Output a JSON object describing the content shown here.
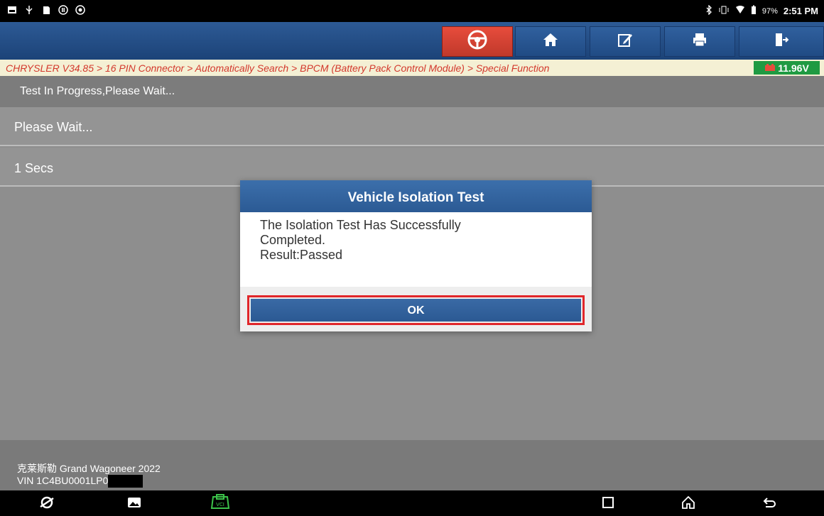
{
  "statusbar": {
    "time": "2:51 PM",
    "battery_percent": "97%"
  },
  "breadcrumb": "CHRYSLER V34.85 > 16 PIN Connector > Automatically Search > BPCM (Battery Pack Control Module) > Special Function",
  "battery_voltage": "11.96V",
  "rows": {
    "status": "Test In Progress,Please Wait...",
    "message": "Please Wait...",
    "timer": "1 Secs"
  },
  "footer": {
    "vehicle": "克莱斯勒 Grand Wagoneer 2022",
    "vin": "VIN 1C4BU0001LP0"
  },
  "dialog": {
    "title": "Vehicle Isolation Test",
    "line1": "The Isolation Test Has Successfully",
    "line2": "Completed.",
    "line3": "Result:Passed",
    "ok_label": "OK"
  },
  "colors": {
    "toolbar": "#2d5a95",
    "breadcrumb_text": "#d3382c",
    "battery_badge": "#1f9a42",
    "ok_highlight": "#e0262a"
  }
}
